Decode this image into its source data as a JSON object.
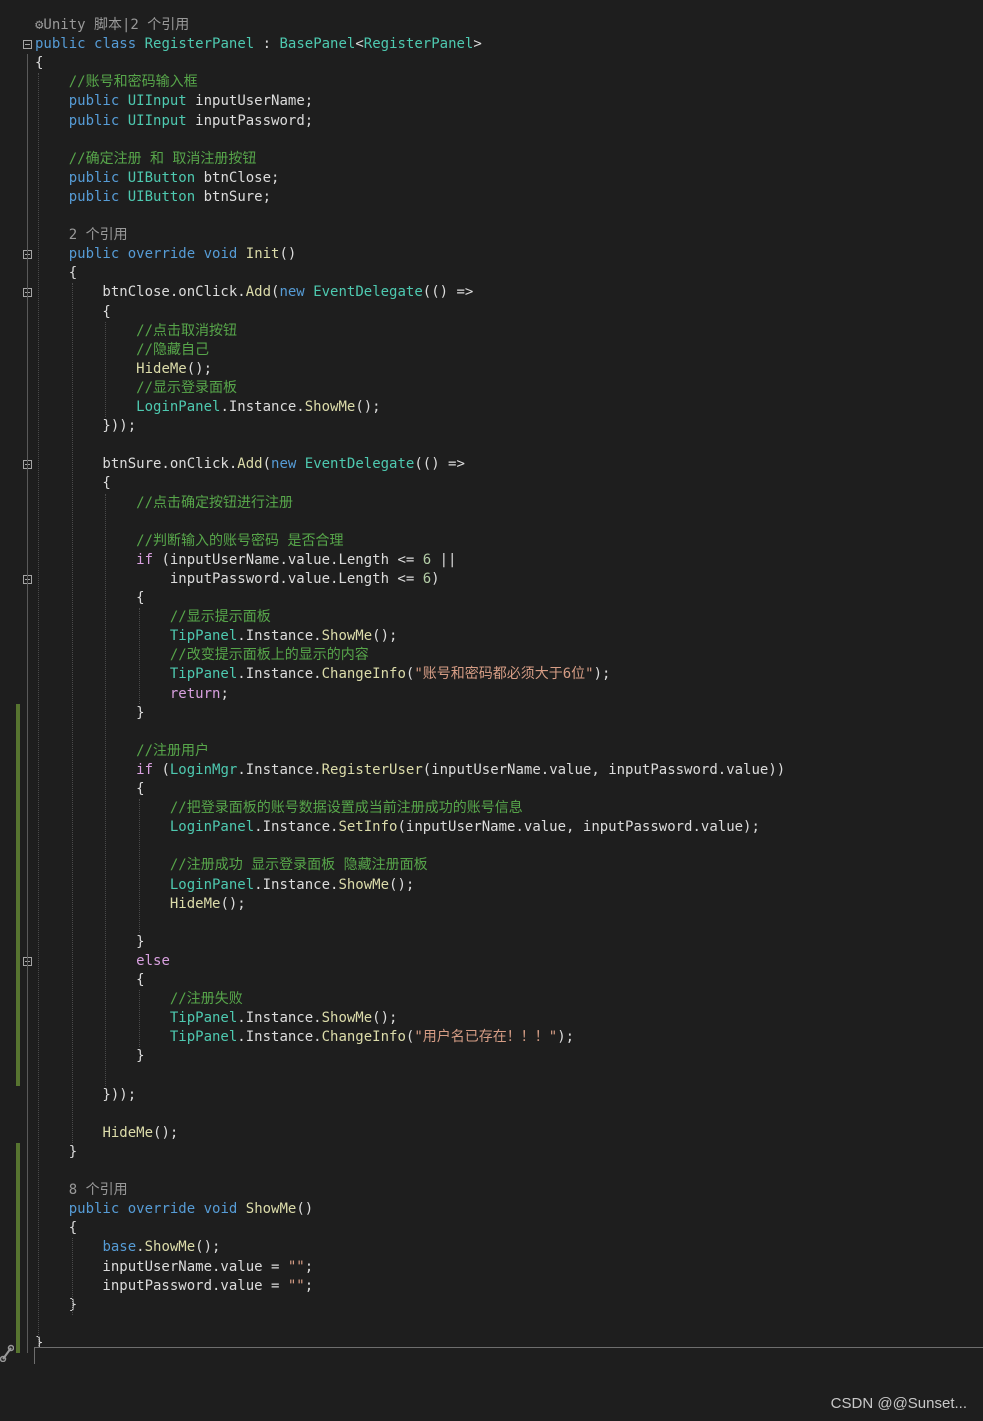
{
  "editor": {
    "language": "csharp",
    "theme_colors": {
      "background": "#1e1e1e",
      "keyword": "#569cd6",
      "type": "#4ec9b0",
      "method": "#dcdcaa",
      "comment": "#57a64a",
      "string": "#d69d85",
      "number": "#b5cea8",
      "control_keyword": "#d8a0df",
      "codelens": "#999999",
      "change_marker": "#577430"
    },
    "lines": [
      [
        [
          "lens",
          "⚙Unity 脚本|2 个引用"
        ]
      ],
      [
        [
          "kw",
          "public"
        ],
        [
          "id",
          " "
        ],
        [
          "kw",
          "class"
        ],
        [
          "id",
          " "
        ],
        [
          "ty",
          "RegisterPanel"
        ],
        [
          "id",
          " : "
        ],
        [
          "ty",
          "BasePanel"
        ],
        [
          "id",
          "<"
        ],
        [
          "ty",
          "RegisterPanel"
        ],
        [
          "id",
          ">"
        ]
      ],
      [
        [
          "id",
          "{"
        ]
      ],
      [
        [
          "id",
          "    "
        ],
        [
          "cm",
          "//账号和密码输入框"
        ]
      ],
      [
        [
          "id",
          "    "
        ],
        [
          "kw",
          "public"
        ],
        [
          "id",
          " "
        ],
        [
          "ty",
          "UIInput"
        ],
        [
          "id",
          " inputUserName;"
        ]
      ],
      [
        [
          "id",
          "    "
        ],
        [
          "kw",
          "public"
        ],
        [
          "id",
          " "
        ],
        [
          "ty",
          "UIInput"
        ],
        [
          "id",
          " inputPassword;"
        ]
      ],
      [
        [
          "id",
          ""
        ]
      ],
      [
        [
          "id",
          "    "
        ],
        [
          "cm",
          "//确定注册 和 取消注册按钮"
        ]
      ],
      [
        [
          "id",
          "    "
        ],
        [
          "kw",
          "public"
        ],
        [
          "id",
          " "
        ],
        [
          "ty",
          "UIButton"
        ],
        [
          "id",
          " btnClose;"
        ]
      ],
      [
        [
          "id",
          "    "
        ],
        [
          "kw",
          "public"
        ],
        [
          "id",
          " "
        ],
        [
          "ty",
          "UIButton"
        ],
        [
          "id",
          " btnSure;"
        ]
      ],
      [
        [
          "id",
          ""
        ]
      ],
      [
        [
          "id",
          "    "
        ],
        [
          "lens",
          "2 个引用"
        ]
      ],
      [
        [
          "id",
          "    "
        ],
        [
          "kw",
          "public"
        ],
        [
          "id",
          " "
        ],
        [
          "kw",
          "override"
        ],
        [
          "id",
          " "
        ],
        [
          "kw",
          "void"
        ],
        [
          "id",
          " "
        ],
        [
          "fn",
          "Init"
        ],
        [
          "id",
          "()"
        ]
      ],
      [
        [
          "id",
          "    {"
        ]
      ],
      [
        [
          "id",
          "        btnClose.onClick."
        ],
        [
          "fn",
          "Add"
        ],
        [
          "id",
          "("
        ],
        [
          "kw",
          "new"
        ],
        [
          "id",
          " "
        ],
        [
          "ty",
          "EventDelegate"
        ],
        [
          "id",
          "(() =>"
        ]
      ],
      [
        [
          "id",
          "        {"
        ]
      ],
      [
        [
          "id",
          "            "
        ],
        [
          "cm",
          "//点击取消按钮"
        ]
      ],
      [
        [
          "id",
          "            "
        ],
        [
          "cm",
          "//隐藏自己"
        ]
      ],
      [
        [
          "id",
          "            "
        ],
        [
          "fn",
          "HideMe"
        ],
        [
          "id",
          "();"
        ]
      ],
      [
        [
          "id",
          "            "
        ],
        [
          "cm",
          "//显示登录面板"
        ]
      ],
      [
        [
          "id",
          "            "
        ],
        [
          "ty",
          "LoginPanel"
        ],
        [
          "id",
          ".Instance."
        ],
        [
          "fn",
          "ShowMe"
        ],
        [
          "id",
          "();"
        ]
      ],
      [
        [
          "id",
          "        }));"
        ]
      ],
      [
        [
          "id",
          ""
        ]
      ],
      [
        [
          "id",
          "        btnSure.onClick."
        ],
        [
          "fn",
          "Add"
        ],
        [
          "id",
          "("
        ],
        [
          "kw",
          "new"
        ],
        [
          "id",
          " "
        ],
        [
          "ty",
          "EventDelegate"
        ],
        [
          "id",
          "(() =>"
        ]
      ],
      [
        [
          "id",
          "        {"
        ]
      ],
      [
        [
          "id",
          "            "
        ],
        [
          "cm",
          "//点击确定按钮进行注册"
        ]
      ],
      [
        [
          "id",
          ""
        ]
      ],
      [
        [
          "id",
          "            "
        ],
        [
          "cm",
          "//判断输入的账号密码 是否合理"
        ]
      ],
      [
        [
          "id",
          "            "
        ],
        [
          "ctl",
          "if"
        ],
        [
          "id",
          " (inputUserName.value.Length <= "
        ],
        [
          "nu",
          "6"
        ],
        [
          "id",
          " ||"
        ]
      ],
      [
        [
          "id",
          "                inputPassword.value.Length <= "
        ],
        [
          "nu",
          "6"
        ],
        [
          "id",
          ")"
        ]
      ],
      [
        [
          "id",
          "            {"
        ]
      ],
      [
        [
          "id",
          "                "
        ],
        [
          "cm",
          "//显示提示面板"
        ]
      ],
      [
        [
          "id",
          "                "
        ],
        [
          "ty",
          "TipPanel"
        ],
        [
          "id",
          ".Instance."
        ],
        [
          "fn",
          "ShowMe"
        ],
        [
          "id",
          "();"
        ]
      ],
      [
        [
          "id",
          "                "
        ],
        [
          "cm",
          "//改变提示面板上的显示的内容"
        ]
      ],
      [
        [
          "id",
          "                "
        ],
        [
          "ty",
          "TipPanel"
        ],
        [
          "id",
          ".Instance."
        ],
        [
          "fn",
          "ChangeInfo"
        ],
        [
          "id",
          "("
        ],
        [
          "st",
          "\"账号和密码都必须大于6位\""
        ],
        [
          "id",
          ");"
        ]
      ],
      [
        [
          "id",
          "                "
        ],
        [
          "ctl",
          "return"
        ],
        [
          "id",
          ";"
        ]
      ],
      [
        [
          "id",
          "            }"
        ]
      ],
      [
        [
          "id",
          ""
        ]
      ],
      [
        [
          "id",
          "            "
        ],
        [
          "cm",
          "//注册用户"
        ]
      ],
      [
        [
          "id",
          "            "
        ],
        [
          "ctl",
          "if"
        ],
        [
          "id",
          " ("
        ],
        [
          "ty",
          "LoginMgr"
        ],
        [
          "id",
          ".Instance."
        ],
        [
          "fn",
          "RegisterUser"
        ],
        [
          "id",
          "(inputUserName.value, inputPassword.value))"
        ]
      ],
      [
        [
          "id",
          "            {"
        ]
      ],
      [
        [
          "id",
          "                "
        ],
        [
          "cm",
          "//把登录面板的账号数据设置成当前注册成功的账号信息"
        ]
      ],
      [
        [
          "id",
          "                "
        ],
        [
          "ty",
          "LoginPanel"
        ],
        [
          "id",
          ".Instance."
        ],
        [
          "fn",
          "SetInfo"
        ],
        [
          "id",
          "(inputUserName.value, inputPassword.value);"
        ]
      ],
      [
        [
          "id",
          ""
        ]
      ],
      [
        [
          "id",
          "                "
        ],
        [
          "cm",
          "//注册成功 显示登录面板 隐藏注册面板"
        ]
      ],
      [
        [
          "id",
          "                "
        ],
        [
          "ty",
          "LoginPanel"
        ],
        [
          "id",
          ".Instance."
        ],
        [
          "fn",
          "ShowMe"
        ],
        [
          "id",
          "();"
        ]
      ],
      [
        [
          "id",
          "                "
        ],
        [
          "fn",
          "HideMe"
        ],
        [
          "id",
          "();"
        ]
      ],
      [
        [
          "id",
          ""
        ]
      ],
      [
        [
          "id",
          "            }"
        ]
      ],
      [
        [
          "id",
          "            "
        ],
        [
          "ctl",
          "else"
        ]
      ],
      [
        [
          "id",
          "            {"
        ]
      ],
      [
        [
          "id",
          "                "
        ],
        [
          "cm",
          "//注册失败"
        ]
      ],
      [
        [
          "id",
          "                "
        ],
        [
          "ty",
          "TipPanel"
        ],
        [
          "id",
          ".Instance."
        ],
        [
          "fn",
          "ShowMe"
        ],
        [
          "id",
          "();"
        ]
      ],
      [
        [
          "id",
          "                "
        ],
        [
          "ty",
          "TipPanel"
        ],
        [
          "id",
          ".Instance."
        ],
        [
          "fn",
          "ChangeInfo"
        ],
        [
          "id",
          "("
        ],
        [
          "st",
          "\"用户名已存在！！！\""
        ],
        [
          "id",
          ");"
        ]
      ],
      [
        [
          "id",
          "            }"
        ]
      ],
      [
        [
          "id",
          ""
        ]
      ],
      [
        [
          "id",
          "        }));"
        ]
      ],
      [
        [
          "id",
          ""
        ]
      ],
      [
        [
          "id",
          "        "
        ],
        [
          "fn",
          "HideMe"
        ],
        [
          "id",
          "();"
        ]
      ],
      [
        [
          "id",
          "    }"
        ]
      ],
      [
        [
          "id",
          ""
        ]
      ],
      [
        [
          "id",
          "    "
        ],
        [
          "lens",
          "8 个引用"
        ]
      ],
      [
        [
          "id",
          "    "
        ],
        [
          "kw",
          "public"
        ],
        [
          "id",
          " "
        ],
        [
          "kw",
          "override"
        ],
        [
          "id",
          " "
        ],
        [
          "kw",
          "void"
        ],
        [
          "id",
          " "
        ],
        [
          "fn",
          "ShowMe"
        ],
        [
          "id",
          "()"
        ]
      ],
      [
        [
          "id",
          "    {"
        ]
      ],
      [
        [
          "id",
          "        "
        ],
        [
          "kw",
          "base"
        ],
        [
          "id",
          "."
        ],
        [
          "fn",
          "ShowMe"
        ],
        [
          "id",
          "();"
        ]
      ],
      [
        [
          "id",
          "        inputUserName.value = "
        ],
        [
          "st",
          "\"\""
        ],
        [
          "id",
          ";"
        ]
      ],
      [
        [
          "id",
          "        inputPassword.value = "
        ],
        [
          "st",
          "\"\""
        ],
        [
          "id",
          ";"
        ]
      ],
      [
        [
          "id",
          "    }"
        ]
      ],
      [
        [
          "id",
          ""
        ]
      ],
      [
        [
          "id",
          "}"
        ]
      ]
    ]
  },
  "watermark": "CSDN @@Sunset..."
}
